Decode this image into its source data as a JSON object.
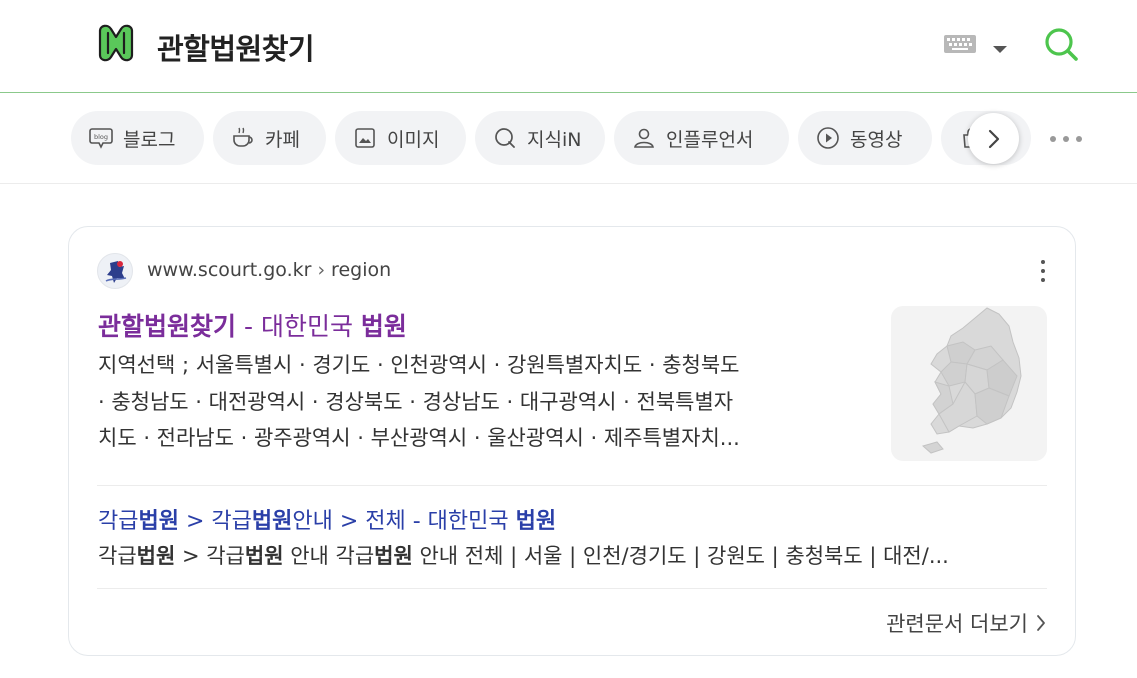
{
  "header": {
    "query": "관할법원찾기",
    "logo_icon": "naver-n-logo-icon",
    "keyboard_icon": "keyboard-icon",
    "dropdown_icon": "chevron-down-icon",
    "search_icon": "search-icon",
    "accent": "#4dc54d"
  },
  "tabs": [
    {
      "label": "블로그",
      "icon": "blog-icon"
    },
    {
      "label": "카페",
      "icon": "cafe-cup-icon"
    },
    {
      "label": "이미지",
      "icon": "image-icon"
    },
    {
      "label": "지식iN",
      "icon": "kin-icon"
    },
    {
      "label": "인플루언서",
      "icon": "person-icon"
    },
    {
      "label": "동영상",
      "icon": "play-icon"
    },
    {
      "label": "",
      "icon": "shopping-bag-icon"
    }
  ],
  "tab_nav": {
    "next_icon": "chevron-right-icon",
    "more_icon": "more-horizontal-icon"
  },
  "result": {
    "site_url": "www.scourt.go.kr",
    "site_sep": "›",
    "site_path": "region",
    "title_main": "관할법원찾기",
    "title_sep": " - ",
    "title_org": "대한민국 ",
    "title_org_bold": "법원",
    "description_lines": [
      "지역선택 ; 서울특별시 · 경기도 · 인천광역시 · 강원특별자치도 · 충청북도",
      "· 충청남도 · 대전광역시 · 경상북도 · 경상남도 · 대구광역시 · 전북특별자",
      "치도 · 전라남도 · 광주광역시 · 부산광역시 · 울산광역시 · 제주특별자치..."
    ],
    "thumbnail": "korea-map-image",
    "sub_link": {
      "part1_plain": "각급",
      "part1_bold": "법원",
      "arrow1": " > ",
      "part2_plain": "각급",
      "part2_bold": "법원",
      "part2_tail": "안내",
      "arrow2": " > ",
      "part3": "전체 - 대한민국 ",
      "part3_bold": "법원"
    },
    "sub_desc": {
      "a_plain": "각급",
      "a_bold": "법원",
      "b": " > 각급",
      "b_bold": "법원",
      "c": " 안내 각급",
      "c_bold": "법원",
      "d": " 안내 전체 | 서울 | 인천/경기도 | 강원도 | 충청북도 | 대전/..."
    },
    "related_label": "관련문서 더보기"
  }
}
